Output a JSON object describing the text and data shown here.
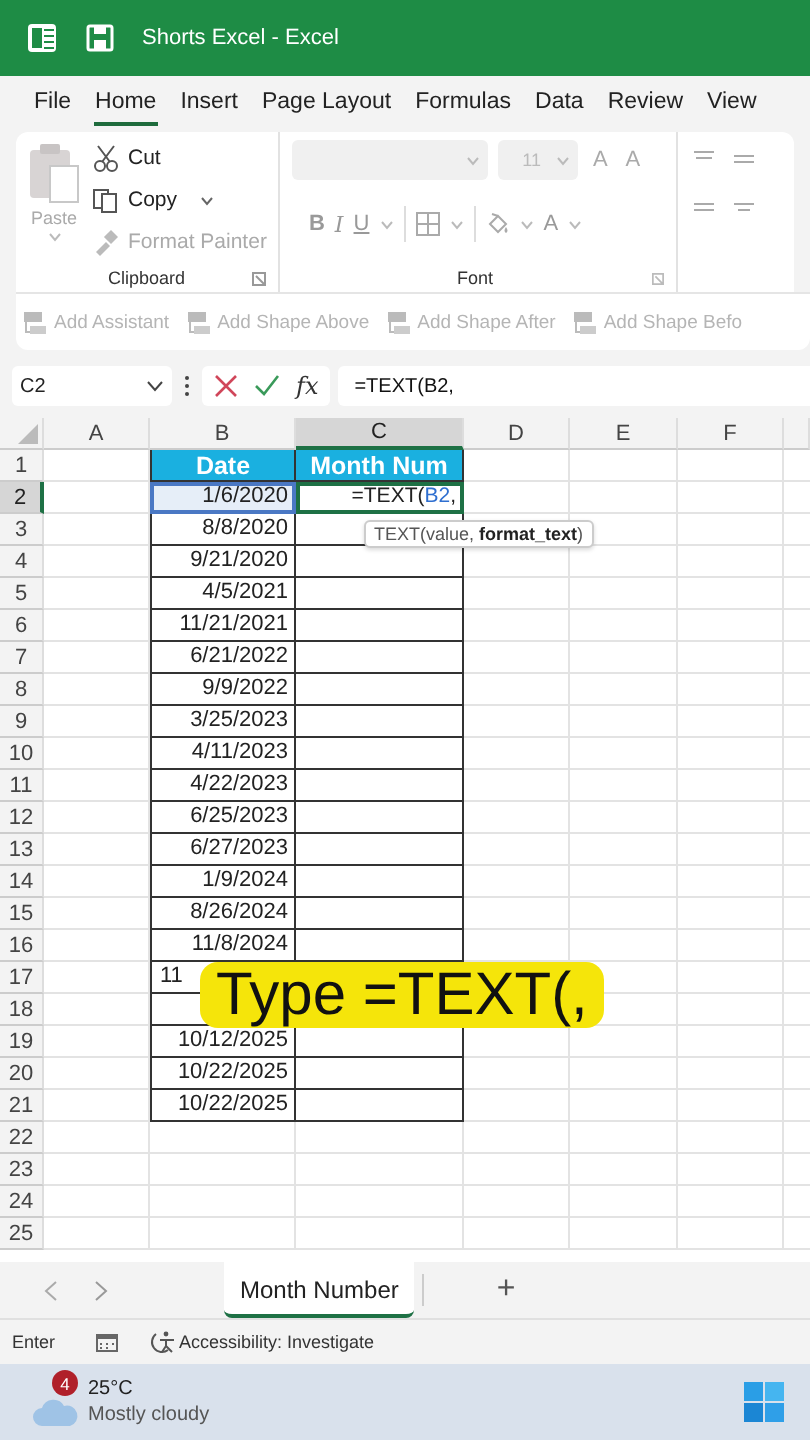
{
  "window": {
    "title": "Shorts Excel  -  Excel"
  },
  "ribbon_tabs": [
    {
      "label": "File",
      "selected": false
    },
    {
      "label": "Home",
      "selected": true
    },
    {
      "label": "Insert",
      "selected": false
    },
    {
      "label": "Page Layout",
      "selected": false
    },
    {
      "label": "Formulas",
      "selected": false
    },
    {
      "label": "Data",
      "selected": false
    },
    {
      "label": "Review",
      "selected": false
    },
    {
      "label": "View",
      "selected": false
    }
  ],
  "clipboard": {
    "paste": {
      "label": "Paste",
      "disabled": true
    },
    "items": [
      {
        "label": "Cut",
        "disabled": false
      },
      {
        "label": "Copy",
        "disabled": false
      },
      {
        "label": "Format Painter",
        "disabled": true
      }
    ],
    "group_label": "Clipboard"
  },
  "font": {
    "size": "11",
    "grow": "A",
    "shrink": "A",
    "bold": "B",
    "italic": "I",
    "underline": "U",
    "font_color_button": "A",
    "group_label": "Font"
  },
  "toolbar": [
    {
      "label": "Add Assistant",
      "disabled": true
    },
    {
      "label": "Add Shape Above",
      "disabled": true
    },
    {
      "label": "Add Shape After",
      "disabled": true
    },
    {
      "label": "Add Shape Befo",
      "disabled": true
    }
  ],
  "formula_bar": {
    "name_box": "C2",
    "fx": "fx",
    "formula": "=TEXT(B2,"
  },
  "columns": [
    {
      "label": "A",
      "selected": false
    },
    {
      "label": "B",
      "selected": false
    },
    {
      "label": "C",
      "selected": true
    },
    {
      "label": "D",
      "selected": false
    },
    {
      "label": "E",
      "selected": false
    },
    {
      "label": "F",
      "selected": false
    }
  ],
  "header": {
    "date": "Date",
    "month": "Month Num"
  },
  "rows": [
    {
      "number": "1",
      "selected": false
    },
    {
      "number": "2",
      "selected": true,
      "date": "1/6/2020"
    },
    {
      "number": "3",
      "selected": false,
      "date": "8/8/2020"
    },
    {
      "number": "4",
      "selected": false,
      "date": "9/21/2020"
    },
    {
      "number": "5",
      "selected": false,
      "date": "4/5/2021"
    },
    {
      "number": "6",
      "selected": false,
      "date": "11/21/2021"
    },
    {
      "number": "7",
      "selected": false,
      "date": "6/21/2022"
    },
    {
      "number": "8",
      "selected": false,
      "date": "9/9/2022"
    },
    {
      "number": "9",
      "selected": false,
      "date": "3/25/2023"
    },
    {
      "number": "10",
      "selected": false,
      "date": "4/11/2023"
    },
    {
      "number": "11",
      "selected": false,
      "date": "4/22/2023"
    },
    {
      "number": "12",
      "selected": false,
      "date": "6/25/2023"
    },
    {
      "number": "13",
      "selected": false,
      "date": "6/27/2023"
    },
    {
      "number": "14",
      "selected": false,
      "date": "1/9/2024"
    },
    {
      "number": "15",
      "selected": false,
      "date": "8/26/2024"
    },
    {
      "number": "16",
      "selected": false,
      "date": "11/8/2024"
    },
    {
      "number": "17",
      "selected": false,
      "date": "11",
      "clipped": true
    },
    {
      "number": "18",
      "selected": false
    },
    {
      "number": "19",
      "selected": false,
      "date": "10/12/2025"
    },
    {
      "number": "20",
      "selected": false,
      "date": "10/22/2025"
    },
    {
      "number": "21",
      "selected": false,
      "date": "10/22/2025"
    },
    {
      "number": "22",
      "selected": false
    },
    {
      "number": "23",
      "selected": false
    },
    {
      "number": "24",
      "selected": false
    },
    {
      "number": "25",
      "selected": false
    }
  ],
  "editing_cell": {
    "prefix": "=TEXT(",
    "ref": "B2",
    "suffix": ","
  },
  "tooltip": "TEXT(value, **format_text**)",
  "caption": "Type =TEXT(,",
  "sheet_tabs": [
    {
      "label": "Month Number",
      "selected": true
    }
  ],
  "add_sheet": "+",
  "status_bar": {
    "mode": "Enter",
    "accessibility": "Accessibility: Investigate"
  },
  "taskbar": {
    "badge": "4",
    "temperature": "25°C",
    "condition": "Mostly cloudy"
  }
}
